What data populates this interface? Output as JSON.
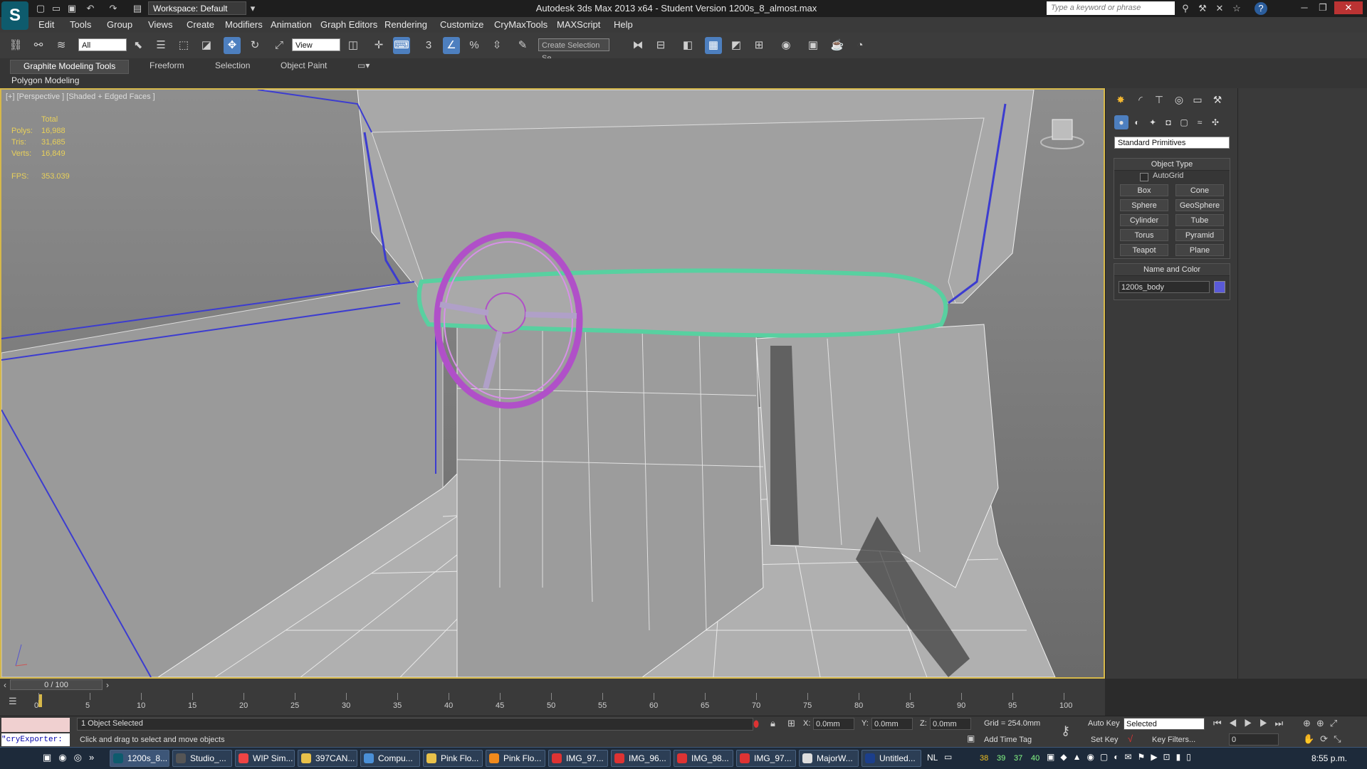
{
  "window": {
    "title": "Autodesk 3ds Max  2013 x64   - Student Version     1200s_8_almost.max",
    "workspace": "Workspace: Default",
    "search_placeholder": "Type a keyword or phrase"
  },
  "menu": [
    "Edit",
    "Tools",
    "Group",
    "Views",
    "Create",
    "Modifiers",
    "Animation",
    "Graph Editors",
    "Rendering",
    "Customize",
    "CryMaxTools",
    "MAXScript",
    "Help"
  ],
  "toolbar": {
    "filter": "All",
    "ref_coord": "View",
    "named_sel": "Create Selection Se"
  },
  "ribbon": {
    "tabs": [
      "Graphite Modeling Tools",
      "Freeform",
      "Selection",
      "Object Paint"
    ],
    "panel": "Polygon Modeling"
  },
  "viewport": {
    "label": "[+] [Perspective ] [Shaded + Edged Faces ]",
    "stats_header": "Total",
    "stats": [
      {
        "label": "Polys:",
        "value": "16,988"
      },
      {
        "label": "Tris:",
        "value": "31,685"
      },
      {
        "label": "Verts:",
        "value": "16,849"
      }
    ],
    "fps_label": "FPS:",
    "fps_value": "353.039"
  },
  "command_panel": {
    "category": "Standard Primitives",
    "object_type": "Object Type",
    "autogrid": "AutoGrid",
    "buttons": [
      "Box",
      "Cone",
      "Sphere",
      "GeoSphere",
      "Cylinder",
      "Tube",
      "Torus",
      "Pyramid",
      "Teapot",
      "Plane"
    ],
    "name_and_color": "Name and Color",
    "object_name": "1200s_body",
    "object_color": "#5a5ad8"
  },
  "timeline": {
    "frame": "0 / 100",
    "ticks": [
      "0",
      "5",
      "10",
      "15",
      "20",
      "25",
      "30",
      "35",
      "40",
      "45",
      "50",
      "55",
      "60",
      "65",
      "70",
      "75",
      "80",
      "85",
      "90",
      "95",
      "100"
    ]
  },
  "status": {
    "script": "\"cryExporter:",
    "selected": "1 Object Selected",
    "prompt": "Click and drag to select and move objects",
    "x": "0.0mm",
    "y": "0.0mm",
    "z": "0.0mm",
    "grid": "Grid = 254.0mm",
    "auto_key": "Auto Key",
    "set_key": "Set Key",
    "key_mode": "Selected",
    "key_filters": "Key Filters...",
    "add_time_tag": "Add Time Tag",
    "frame_field": "0"
  },
  "taskbar": {
    "items": [
      "1200s_8...",
      "Studio_...",
      "WIP Sim...",
      "397CAN...",
      "Compu...",
      "Pink Flo...",
      "Pink Flo...",
      "IMG_97...",
      "IMG_96...",
      "IMG_98...",
      "IMG_97...",
      "MajorW...",
      "Untitled..."
    ],
    "lang": "NL",
    "tray_nums": [
      "38",
      "39",
      "37",
      "40"
    ],
    "clock": "8:55 p.m."
  }
}
